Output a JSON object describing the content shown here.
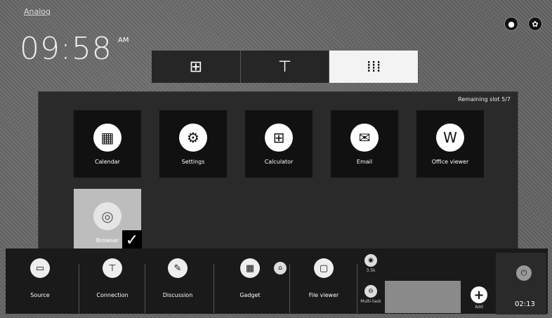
{
  "header": {
    "title": "Analog",
    "clock": "09:58",
    "clock_suffix": "AM"
  },
  "top_icons": [
    {
      "icon": "user-icon",
      "glyph": "●"
    },
    {
      "icon": "gear-icon",
      "glyph": "✿"
    }
  ],
  "tabs": [
    {
      "icon": "windows-icon",
      "glyph": "⊞"
    },
    {
      "icon": "whiteboard-icon",
      "glyph": "⊤"
    },
    {
      "icon": "apps-grid-icon",
      "glyph": "⁞⁞⁞"
    }
  ],
  "panel": {
    "remaining": "Remaining slot 5/7",
    "apps": [
      {
        "label": "Calendar",
        "glyph": "▦"
      },
      {
        "label": "Settings",
        "glyph": "⚙"
      },
      {
        "label": "Calculator",
        "glyph": "⊞"
      },
      {
        "label": "Email",
        "glyph": "✉"
      },
      {
        "label": "Office viewer",
        "glyph": "W"
      }
    ],
    "selected_app": {
      "label": "Browser",
      "glyph": "◎"
    },
    "checkmark": "✓"
  },
  "taskbar": {
    "items": [
      {
        "label": "Source",
        "glyph": "▭"
      },
      {
        "label": "Connection",
        "glyph": "⊤"
      },
      {
        "label": "Discussion",
        "glyph": "✎"
      },
      {
        "label": "Gadget",
        "glyph": "▦"
      },
      {
        "label": "File viewer",
        "glyph": "▢"
      }
    ],
    "home_glyph": "⌂",
    "mini_top": {
      "glyph": "◉",
      "label": "3.5k"
    },
    "mini_bottom": {
      "glyph": "⊖",
      "label": "Multi-task"
    },
    "add": {
      "glyph": "+",
      "label": "Add"
    },
    "right_glyph": "⏻",
    "time": "02:13"
  }
}
